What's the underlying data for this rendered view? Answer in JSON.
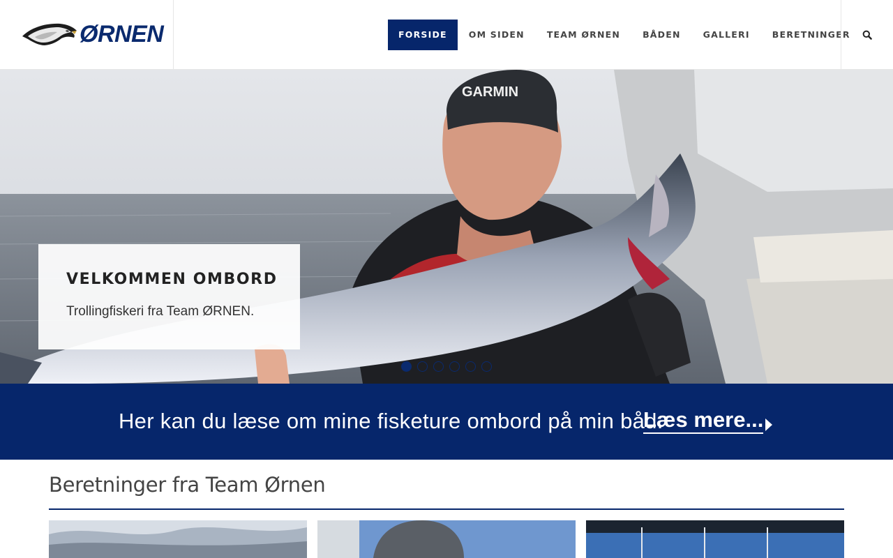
{
  "header": {
    "logo_text": "ØRNEN",
    "nav": [
      {
        "label": "FORSIDE",
        "active": true
      },
      {
        "label": "OM SIDEN",
        "active": false
      },
      {
        "label": "TEAM ØRNEN",
        "active": false
      },
      {
        "label": "BÅDEN",
        "active": false
      },
      {
        "label": "GALLERI",
        "active": false
      },
      {
        "label": "BERETNINGER",
        "active": false
      }
    ],
    "search_icon": "search-icon"
  },
  "hero": {
    "title": "VELKOMMEN OMBORD",
    "subtitle": "Trollingfiskeri fra Team ØRNEN.",
    "slides": 6,
    "active_slide": 1
  },
  "banner": {
    "text": "Her kan du læse om mine fisketure ombord på min båd.",
    "link_label": "Læs mere...",
    "arrow_icon": "caret-right-icon"
  },
  "section": {
    "title": "Beretninger fra Team Ørnen",
    "cards": 3
  },
  "colors": {
    "brand": "#06266b",
    "text": "#333333"
  }
}
